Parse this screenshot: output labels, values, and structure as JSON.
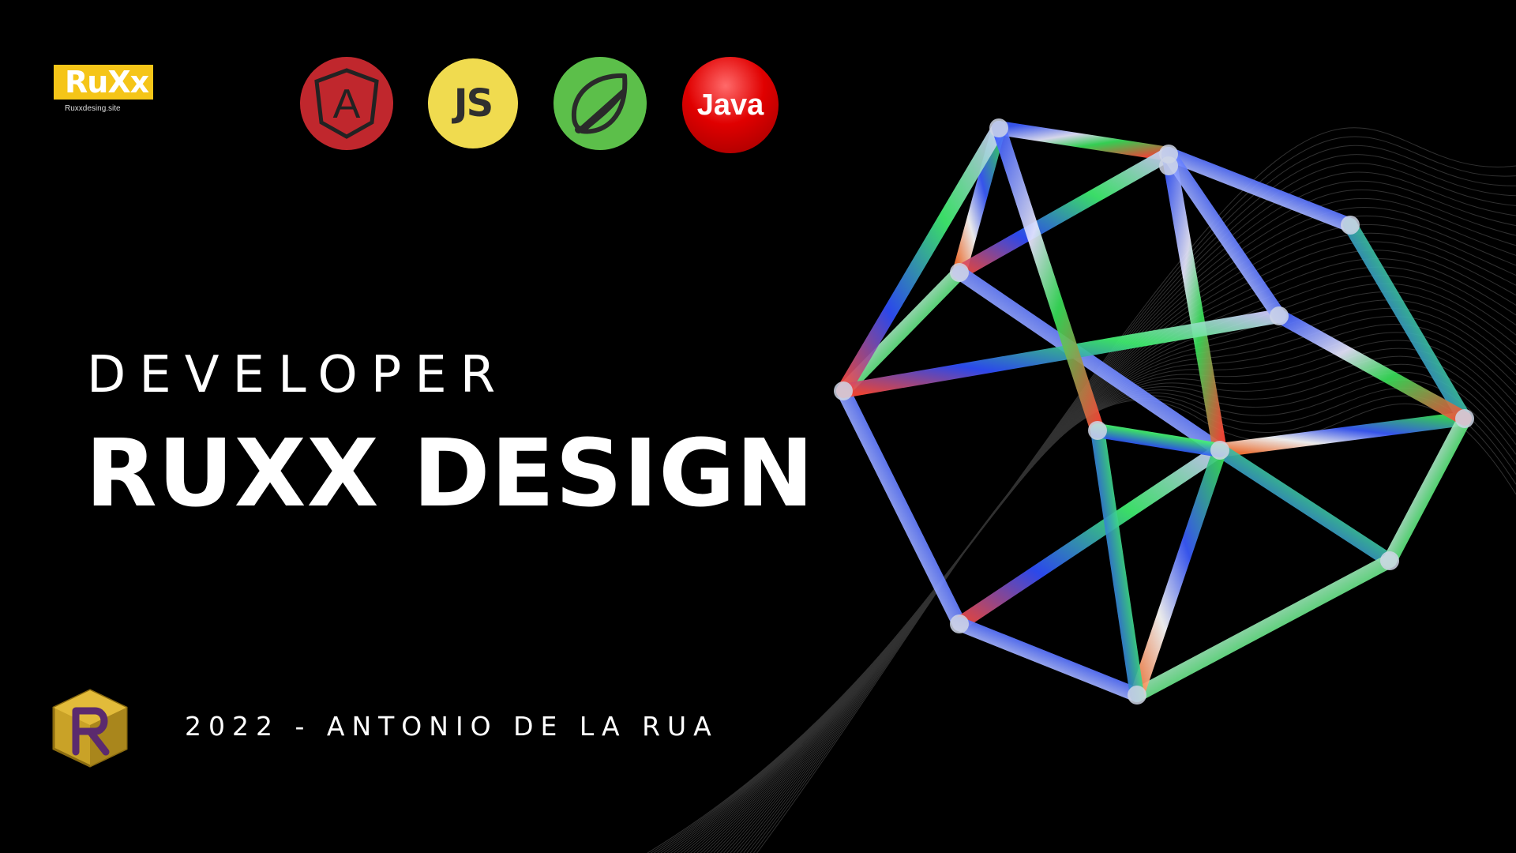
{
  "brand": {
    "logo_text_main": "RuX",
    "logo_text_tail": "x",
    "url": "Ruxxdesing.site"
  },
  "tech_icons": {
    "angular": {
      "name": "angular-icon",
      "letter": "A",
      "color": "#c0272d"
    },
    "javascript": {
      "name": "javascript-icon",
      "label": "JS",
      "color": "#f0db4f"
    },
    "spring": {
      "name": "spring-leaf-icon",
      "color": "#5cbf4a"
    },
    "java": {
      "name": "java-icon",
      "label": "Java",
      "color": "#e00000"
    }
  },
  "headline": {
    "kicker": "DEVELOPER",
    "title": "RUXX DESIGN"
  },
  "byline": "2022 - ANTONIO DE LA RUA",
  "colors": {
    "background": "#000000",
    "text": "#ffffff",
    "brand_yellow": "#f5c518"
  }
}
